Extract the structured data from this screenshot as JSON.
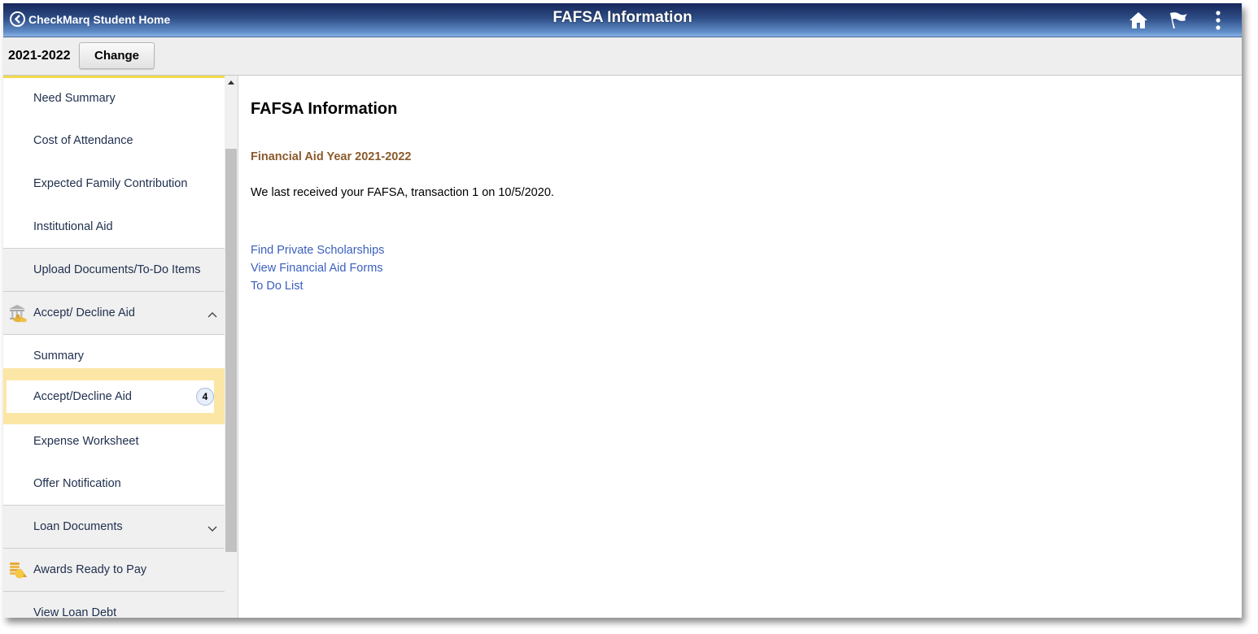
{
  "banner": {
    "back_label": "CheckMarq Student Home",
    "title": "FAFSA Information",
    "icons": [
      "home-icon",
      "flag-icon",
      "more-vertical-icon"
    ]
  },
  "subbar": {
    "year": "2021-2022",
    "change_label": "Change"
  },
  "sidebar": {
    "items": [
      {
        "label": "Need Summary",
        "type": "sub"
      },
      {
        "label": "Cost of Attendance",
        "type": "sub"
      },
      {
        "label": "Expected Family Contribution",
        "type": "sub"
      },
      {
        "label": "Institutional Aid",
        "type": "sub"
      },
      {
        "label": "Upload Documents/To-Do Items",
        "type": "group"
      },
      {
        "label": "Accept/ Decline Aid",
        "type": "group",
        "icon": "bank-coins-icon",
        "expanded": true
      },
      {
        "label": "Summary",
        "type": "sub"
      },
      {
        "label": "Accept/Decline Aid",
        "type": "sub",
        "selected": true,
        "badge": "4"
      },
      {
        "label": "Expense Worksheet",
        "type": "sub"
      },
      {
        "label": "Offer Notification",
        "type": "sub"
      },
      {
        "label": "Loan Documents",
        "type": "group",
        "expanded": false
      },
      {
        "label": "Awards Ready to Pay",
        "type": "group",
        "icon": "coin-stack-icon"
      },
      {
        "label": "View Loan Debt",
        "type": "group"
      }
    ]
  },
  "main": {
    "title": "FAFSA Information",
    "aid_year": "Financial Aid Year 2021-2022",
    "fafsa_text": "We last received your FAFSA, transaction 1 on 10/5/2020.",
    "links": [
      "Find Private Scholarships",
      "View Financial Aid Forms",
      "To Do List"
    ]
  },
  "colors": {
    "banner_dark": "#16275a",
    "banner_light": "#86b1e2",
    "highlight": "#fbe6a6",
    "aid_year": "#8b5a2b",
    "link": "#3a5fbf",
    "nav_text": "#1f2f4e"
  }
}
